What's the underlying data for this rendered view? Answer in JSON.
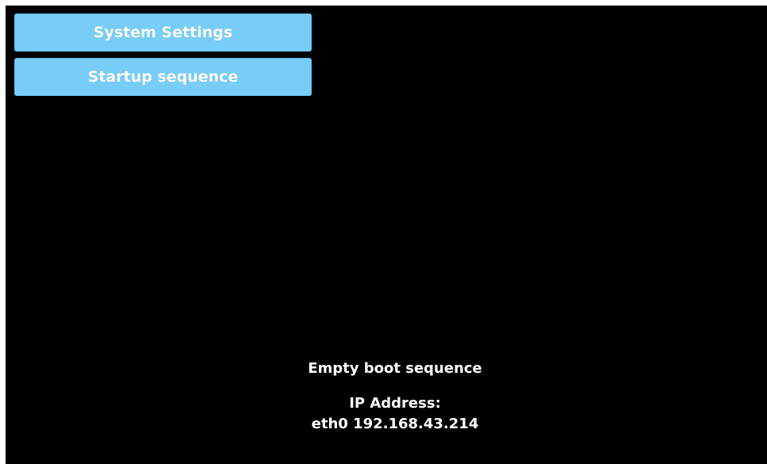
{
  "menu": {
    "system_settings_label": "System Settings",
    "startup_sequence_label": "Startup sequence"
  },
  "status": {
    "boot_message": "Empty boot sequence",
    "ip_label": "IP Address:",
    "ip_value": "eth0 192.168.43.214"
  },
  "colors": {
    "background": "#000000",
    "button": "#77cdf8",
    "text": "#ffffff"
  }
}
